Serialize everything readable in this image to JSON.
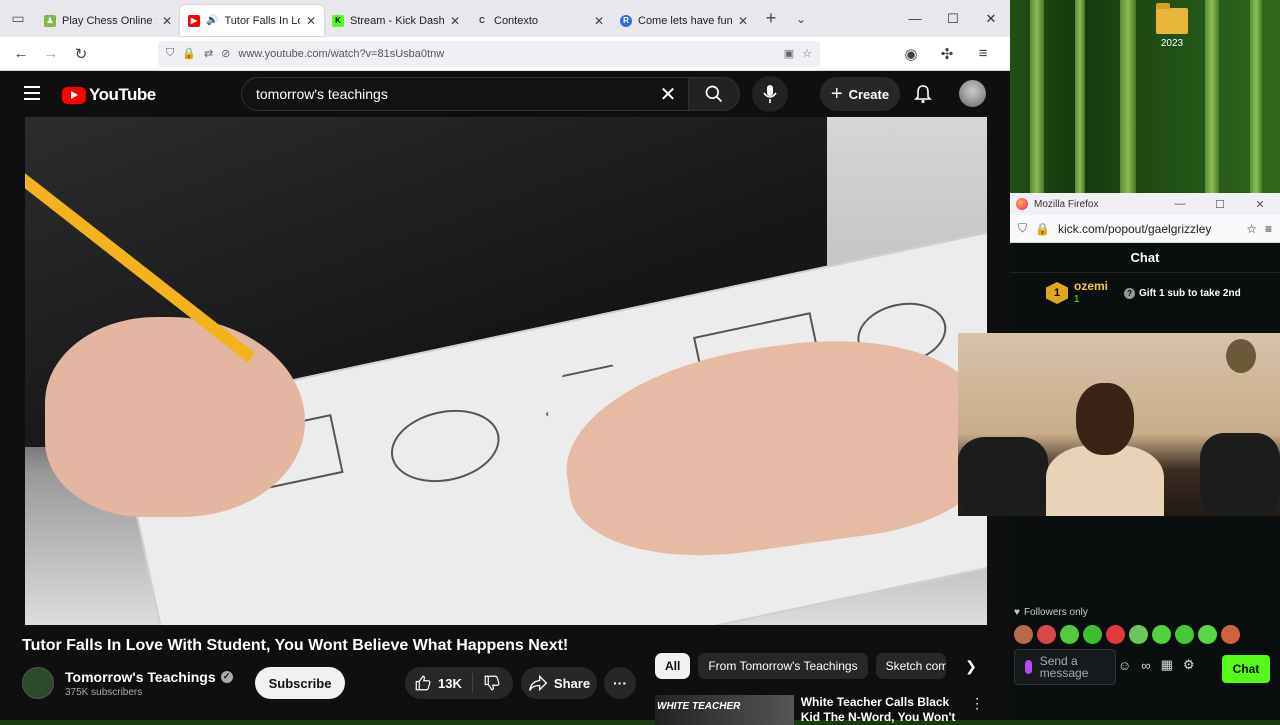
{
  "desktop": {
    "folder_label": "2023"
  },
  "browser": {
    "tabs": [
      {
        "title": "Play Chess Online for",
        "favicon_color": "#81b64c",
        "favicon_glyph": "♟",
        "active": false
      },
      {
        "title": "Tutor Falls In Love",
        "favicon_color": "#ff0000",
        "favicon_glyph": "▶",
        "active": true
      },
      {
        "title": "Stream - Kick Dashbo",
        "favicon_color": "#53fc18",
        "favicon_glyph": "K",
        "active": false
      },
      {
        "title": "Contexto",
        "favicon_color": "#333333",
        "favicon_glyph": "C",
        "active": false
      },
      {
        "title": "Come lets have fun",
        "favicon_color": "#2f6fd6",
        "favicon_glyph": "R",
        "active": false
      }
    ],
    "url": "www.youtube.com/watch?v=81sUsba0tnw"
  },
  "youtube": {
    "logo_text": "YouTube",
    "search_value": "tomorrow's teachings",
    "create_label": "Create",
    "video_title": "Tutor Falls In Love With Student, You Wont Believe What Happens Next!",
    "channel_name": "Tomorrow's Teachings",
    "subscribers": "375K subscribers",
    "subscribe_label": "Subscribe",
    "likes": "13K",
    "share_label": "Share",
    "chips": [
      "All",
      "From Tomorrow's Teachings",
      "Sketch come"
    ],
    "recommendation": {
      "thumb_text": "WHITE TEACHER",
      "title": "White Teacher Calls Black Kid The N-Word, You Won't Believe"
    }
  },
  "kick_window": {
    "window_title": "Mozilla Firefox",
    "url": "kick.com/popout/gaelgrizzley",
    "chat_header": "Chat",
    "gift": {
      "rank": "1",
      "user": "ozemi",
      "count": "1",
      "cta": "Gift 1 sub to take 2nd"
    },
    "followers_only": "Followers only",
    "input_placeholder": "Send a message",
    "send_label": "Chat"
  },
  "colors": {
    "youtube_bg": "#0f0f0f",
    "kick_green": "#53fc18",
    "youtube_red": "#ff0000"
  }
}
